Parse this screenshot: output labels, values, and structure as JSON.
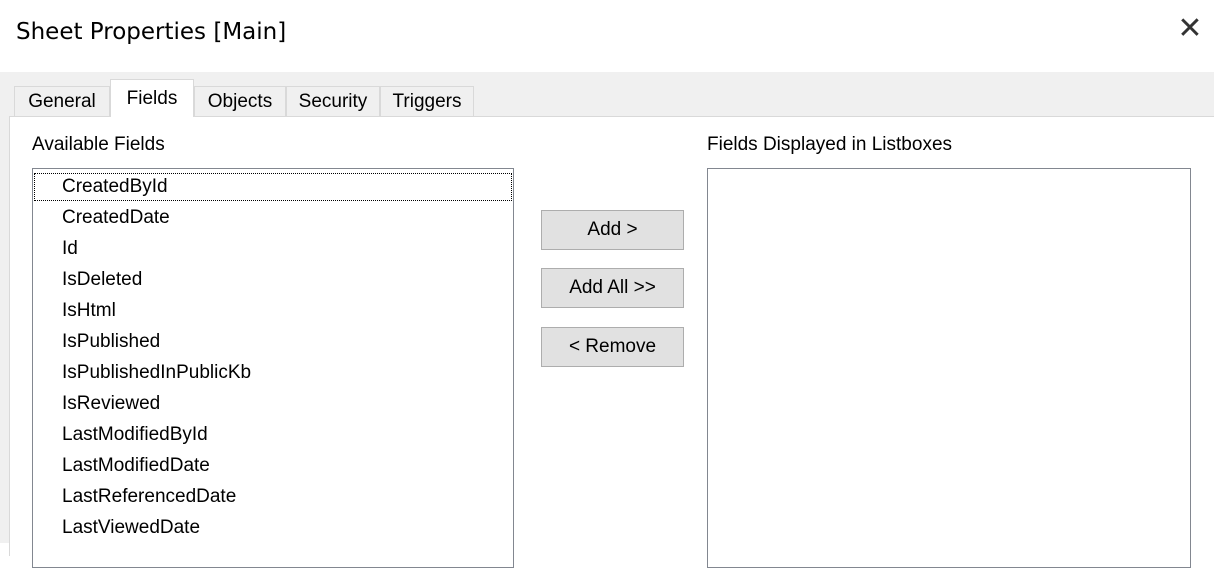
{
  "window": {
    "title": "Sheet Properties [Main]",
    "close_glyph": "✕"
  },
  "tabs": [
    {
      "label": "General"
    },
    {
      "label": "Fields"
    },
    {
      "label": "Objects"
    },
    {
      "label": "Security"
    },
    {
      "label": "Triggers"
    }
  ],
  "active_tab": "Fields",
  "available": {
    "label": "Available Fields",
    "items": [
      "CreatedById",
      "CreatedDate",
      "Id",
      "IsDeleted",
      "IsHtml",
      "IsPublished",
      "IsPublishedInPublicKb",
      "IsReviewed",
      "LastModifiedById",
      "LastModifiedDate",
      "LastReferencedDate",
      "LastViewedDate"
    ]
  },
  "buttons": {
    "add": "Add >",
    "add_all": "Add All >>",
    "remove": "< Remove"
  },
  "displayed": {
    "label": "Fields Displayed in Listboxes",
    "items": []
  }
}
